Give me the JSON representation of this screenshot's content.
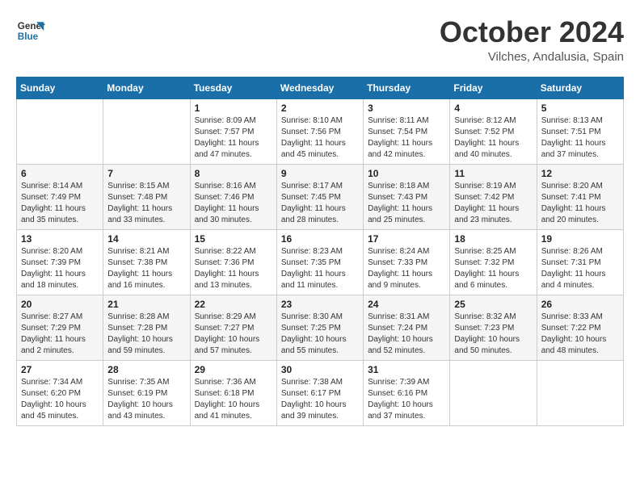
{
  "header": {
    "logo_line1": "General",
    "logo_line2": "Blue",
    "month": "October 2024",
    "location": "Vilches, Andalusia, Spain"
  },
  "weekdays": [
    "Sunday",
    "Monday",
    "Tuesday",
    "Wednesday",
    "Thursday",
    "Friday",
    "Saturday"
  ],
  "weeks": [
    [
      {
        "day": "",
        "info": ""
      },
      {
        "day": "",
        "info": ""
      },
      {
        "day": "1",
        "info": "Sunrise: 8:09 AM\nSunset: 7:57 PM\nDaylight: 11 hours and 47 minutes."
      },
      {
        "day": "2",
        "info": "Sunrise: 8:10 AM\nSunset: 7:56 PM\nDaylight: 11 hours and 45 minutes."
      },
      {
        "day": "3",
        "info": "Sunrise: 8:11 AM\nSunset: 7:54 PM\nDaylight: 11 hours and 42 minutes."
      },
      {
        "day": "4",
        "info": "Sunrise: 8:12 AM\nSunset: 7:52 PM\nDaylight: 11 hours and 40 minutes."
      },
      {
        "day": "5",
        "info": "Sunrise: 8:13 AM\nSunset: 7:51 PM\nDaylight: 11 hours and 37 minutes."
      }
    ],
    [
      {
        "day": "6",
        "info": "Sunrise: 8:14 AM\nSunset: 7:49 PM\nDaylight: 11 hours and 35 minutes."
      },
      {
        "day": "7",
        "info": "Sunrise: 8:15 AM\nSunset: 7:48 PM\nDaylight: 11 hours and 33 minutes."
      },
      {
        "day": "8",
        "info": "Sunrise: 8:16 AM\nSunset: 7:46 PM\nDaylight: 11 hours and 30 minutes."
      },
      {
        "day": "9",
        "info": "Sunrise: 8:17 AM\nSunset: 7:45 PM\nDaylight: 11 hours and 28 minutes."
      },
      {
        "day": "10",
        "info": "Sunrise: 8:18 AM\nSunset: 7:43 PM\nDaylight: 11 hours and 25 minutes."
      },
      {
        "day": "11",
        "info": "Sunrise: 8:19 AM\nSunset: 7:42 PM\nDaylight: 11 hours and 23 minutes."
      },
      {
        "day": "12",
        "info": "Sunrise: 8:20 AM\nSunset: 7:41 PM\nDaylight: 11 hours and 20 minutes."
      }
    ],
    [
      {
        "day": "13",
        "info": "Sunrise: 8:20 AM\nSunset: 7:39 PM\nDaylight: 11 hours and 18 minutes."
      },
      {
        "day": "14",
        "info": "Sunrise: 8:21 AM\nSunset: 7:38 PM\nDaylight: 11 hours and 16 minutes."
      },
      {
        "day": "15",
        "info": "Sunrise: 8:22 AM\nSunset: 7:36 PM\nDaylight: 11 hours and 13 minutes."
      },
      {
        "day": "16",
        "info": "Sunrise: 8:23 AM\nSunset: 7:35 PM\nDaylight: 11 hours and 11 minutes."
      },
      {
        "day": "17",
        "info": "Sunrise: 8:24 AM\nSunset: 7:33 PM\nDaylight: 11 hours and 9 minutes."
      },
      {
        "day": "18",
        "info": "Sunrise: 8:25 AM\nSunset: 7:32 PM\nDaylight: 11 hours and 6 minutes."
      },
      {
        "day": "19",
        "info": "Sunrise: 8:26 AM\nSunset: 7:31 PM\nDaylight: 11 hours and 4 minutes."
      }
    ],
    [
      {
        "day": "20",
        "info": "Sunrise: 8:27 AM\nSunset: 7:29 PM\nDaylight: 11 hours and 2 minutes."
      },
      {
        "day": "21",
        "info": "Sunrise: 8:28 AM\nSunset: 7:28 PM\nDaylight: 10 hours and 59 minutes."
      },
      {
        "day": "22",
        "info": "Sunrise: 8:29 AM\nSunset: 7:27 PM\nDaylight: 10 hours and 57 minutes."
      },
      {
        "day": "23",
        "info": "Sunrise: 8:30 AM\nSunset: 7:25 PM\nDaylight: 10 hours and 55 minutes."
      },
      {
        "day": "24",
        "info": "Sunrise: 8:31 AM\nSunset: 7:24 PM\nDaylight: 10 hours and 52 minutes."
      },
      {
        "day": "25",
        "info": "Sunrise: 8:32 AM\nSunset: 7:23 PM\nDaylight: 10 hours and 50 minutes."
      },
      {
        "day": "26",
        "info": "Sunrise: 8:33 AM\nSunset: 7:22 PM\nDaylight: 10 hours and 48 minutes."
      }
    ],
    [
      {
        "day": "27",
        "info": "Sunrise: 7:34 AM\nSunset: 6:20 PM\nDaylight: 10 hours and 45 minutes."
      },
      {
        "day": "28",
        "info": "Sunrise: 7:35 AM\nSunset: 6:19 PM\nDaylight: 10 hours and 43 minutes."
      },
      {
        "day": "29",
        "info": "Sunrise: 7:36 AM\nSunset: 6:18 PM\nDaylight: 10 hours and 41 minutes."
      },
      {
        "day": "30",
        "info": "Sunrise: 7:38 AM\nSunset: 6:17 PM\nDaylight: 10 hours and 39 minutes."
      },
      {
        "day": "31",
        "info": "Sunrise: 7:39 AM\nSunset: 6:16 PM\nDaylight: 10 hours and 37 minutes."
      },
      {
        "day": "",
        "info": ""
      },
      {
        "day": "",
        "info": ""
      }
    ]
  ]
}
